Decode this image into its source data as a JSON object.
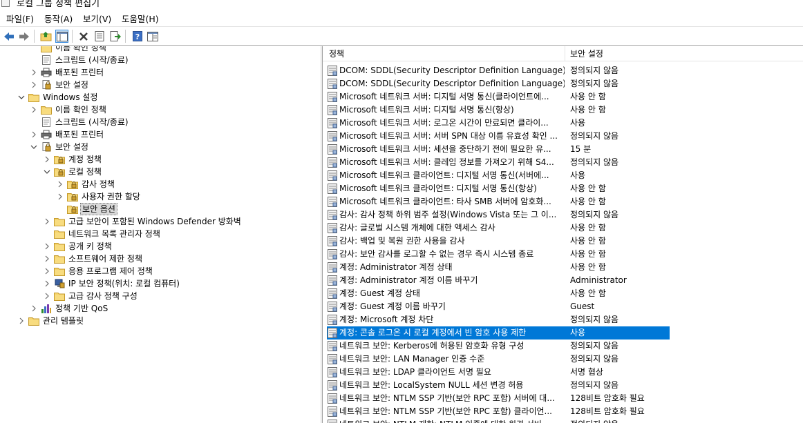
{
  "window": {
    "title": "로컬 그룹 정책 편집기"
  },
  "menu": [
    {
      "label": "파일(F)"
    },
    {
      "label": "동작(A)"
    },
    {
      "label": "보기(V)"
    },
    {
      "label": "도움말(H)"
    }
  ],
  "toolbar": [
    {
      "name": "back-icon"
    },
    {
      "name": "forward-icon"
    },
    {
      "name": "up-folder-icon"
    },
    {
      "name": "show-hide-tree-icon"
    },
    {
      "name": "delete-icon"
    },
    {
      "name": "properties-icon"
    },
    {
      "name": "export-list-icon"
    },
    {
      "name": "help-icon"
    },
    {
      "name": "extended-view-icon"
    }
  ],
  "tree": [
    {
      "label": "이름 확인 정책",
      "icon": "folder",
      "expander": "none"
    },
    {
      "label": "스크립트 (시작/종료)",
      "icon": "script",
      "expander": "none"
    },
    {
      "label": "배포된 프린터",
      "icon": "printer",
      "expander": "collapsed"
    },
    {
      "label": "보안 설정",
      "icon": "security",
      "expander": "collapsed"
    },
    {
      "label": "Windows 설정",
      "icon": "folder",
      "expander": "expanded"
    },
    {
      "label": "이름 확인 정책",
      "icon": "folder",
      "expander": "collapsed"
    },
    {
      "label": "스크립트 (시작/종료)",
      "icon": "script",
      "expander": "none"
    },
    {
      "label": "배포된 프린터",
      "icon": "printer",
      "expander": "collapsed"
    },
    {
      "label": "보안 설정",
      "icon": "security",
      "expander": "expanded"
    },
    {
      "label": "계정 정책",
      "icon": "folder-lock",
      "expander": "collapsed"
    },
    {
      "label": "로컬 정책",
      "icon": "folder-lock",
      "expander": "expanded"
    },
    {
      "label": "감사 정책",
      "icon": "folder-lock",
      "expander": "collapsed"
    },
    {
      "label": "사용자 권한 할당",
      "icon": "folder-lock",
      "expander": "collapsed"
    },
    {
      "label": "보안 옵션",
      "icon": "folder-lock",
      "expander": "none",
      "selected": true
    },
    {
      "label": "고급 보안이 포함된 Windows Defender 방화벽",
      "icon": "folder",
      "expander": "collapsed"
    },
    {
      "label": "네트워크 목록 관리자 정책",
      "icon": "folder",
      "expander": "none"
    },
    {
      "label": "공개 키 정책",
      "icon": "folder",
      "expander": "collapsed"
    },
    {
      "label": "소프트웨어 제한 정책",
      "icon": "folder",
      "expander": "collapsed"
    },
    {
      "label": "응용 프로그램 제어 정책",
      "icon": "folder",
      "expander": "collapsed"
    },
    {
      "label": "IP 보안 정책(위치: 로컬 컴퓨터)",
      "icon": "ipsec",
      "expander": "collapsed"
    },
    {
      "label": "고급 감사 정책 구성",
      "icon": "folder",
      "expander": "collapsed"
    },
    {
      "label": "정책 기반 QoS",
      "icon": "chart",
      "expander": "collapsed"
    },
    {
      "label": "관리 템플릿",
      "icon": "folder",
      "expander": "collapsed"
    }
  ],
  "list": {
    "columns": {
      "policy": "정책",
      "setting": "보안 설정"
    },
    "rows": [
      {
        "policy": "DCOM: SDDL(Security Descriptor Definition Language) 구...",
        "setting": "정의되지 않음"
      },
      {
        "policy": "DCOM: SDDL(Security Descriptor Definition Language) 구...",
        "setting": "정의되지 않음"
      },
      {
        "policy": "Microsoft 네트워크 서버: 디지털 서명 통신(클라이언트에...",
        "setting": "사용 안 함"
      },
      {
        "policy": "Microsoft 네트워크 서버: 디지털 서명 통신(항상)",
        "setting": "사용 안 함"
      },
      {
        "policy": "Microsoft 네트워크 서버: 로그온 시간이 만료되면 클라이...",
        "setting": "사용"
      },
      {
        "policy": "Microsoft 네트워크 서버: 서버 SPN 대상 이름 유효성 확인 ...",
        "setting": "정의되지 않음"
      },
      {
        "policy": "Microsoft 네트워크 서버: 세션을 중단하기 전에 필요한 유...",
        "setting": "15 분"
      },
      {
        "policy": "Microsoft 네트워크 서버: 클레임 정보를 가져오기 위해 S4...",
        "setting": "정의되지 않음"
      },
      {
        "policy": "Microsoft 네트워크 클라이언트: 디지털 서명 통신(서버에...",
        "setting": "사용"
      },
      {
        "policy": "Microsoft 네트워크 클라이언트: 디지털 서명 통신(항상)",
        "setting": "사용 안 함"
      },
      {
        "policy": "Microsoft 네트워크 클라이언트: 타사 SMB 서버에 암호화...",
        "setting": "사용 안 함"
      },
      {
        "policy": "감사: 감사 정책 하위 범주 설정(Windows Vista 또는 그 이...",
        "setting": "정의되지 않음"
      },
      {
        "policy": "감사: 글로벌 시스템 개체에 대한 액세스 감사",
        "setting": "사용 안 함"
      },
      {
        "policy": "감사: 백업 및 복원 권한 사용을 감사",
        "setting": "사용 안 함"
      },
      {
        "policy": "감사: 보안 감사를 로그할 수 없는 경우 즉시 시스템 종료",
        "setting": "사용 안 함"
      },
      {
        "policy": "계정: Administrator 계정 상태",
        "setting": "사용 안 함"
      },
      {
        "policy": "계정: Administrator 계정 이름 바꾸기",
        "setting": "Administrator"
      },
      {
        "policy": "계정: Guest 계정 상태",
        "setting": "사용 안 함"
      },
      {
        "policy": "계정: Guest 계정 이름 바꾸기",
        "setting": "Guest"
      },
      {
        "policy": "계정: Microsoft 계정 차단",
        "setting": "정의되지 않음"
      },
      {
        "policy": "계정: 콘솔 로그온 시 로컬 계정에서 빈 암호 사용 제한",
        "setting": "사용",
        "selected": true
      },
      {
        "policy": "네트워크 보안: Kerberos에 허용된 암호화 유형 구성",
        "setting": "정의되지 않음"
      },
      {
        "policy": "네트워크 보안: LAN Manager 인증 수준",
        "setting": "정의되지 않음"
      },
      {
        "policy": "네트워크 보안: LDAP 클라이언트 서명 필요",
        "setting": "서명 협상"
      },
      {
        "policy": "네트워크 보안: LocalSystem NULL 세션 변경 허용",
        "setting": "정의되지 않음"
      },
      {
        "policy": "네트워크 보안: NTLM SSP 기반(보안 RPC 포함) 서버에 대...",
        "setting": "128비트 암호화 필요"
      },
      {
        "policy": "네트워크 보안: NTLM SSP 기반(보안 RPC 포함) 클라이언...",
        "setting": "128비트 암호화 필요"
      },
      {
        "policy": "네트워크 보안: NTLM 제한: NTLM 인증에 대한 원격 서버...",
        "setting": "정의되지 않음"
      }
    ]
  }
}
